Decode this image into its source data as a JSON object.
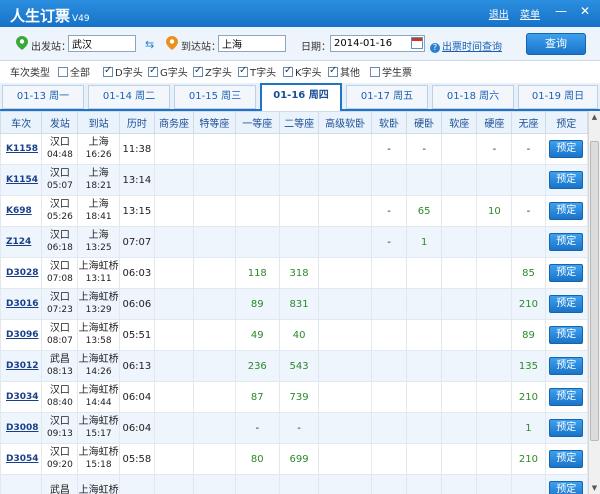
{
  "app": {
    "title": "人生订票",
    "version": "V49"
  },
  "titlebar": {
    "logout": "退出",
    "menu": "菜单",
    "minimize": "—",
    "close": "✕"
  },
  "search": {
    "from_label": "出发站：",
    "from_value": "武汉",
    "swap": "⇆",
    "to_label": "到达站：",
    "to_value": "上海",
    "date_label": "日期：",
    "date_value": "2014-01-16",
    "help_link": "出票时间查询",
    "query_button": "查询"
  },
  "filters": {
    "label": "车次类型",
    "options": [
      {
        "label": "全部",
        "checked": false
      },
      {
        "label": "D字头",
        "checked": true
      },
      {
        "label": "G字头",
        "checked": true
      },
      {
        "label": "Z字头",
        "checked": true
      },
      {
        "label": "T字头",
        "checked": true
      },
      {
        "label": "K字头",
        "checked": true
      },
      {
        "label": "其他",
        "checked": true
      },
      {
        "label": "学生票",
        "checked": false
      }
    ]
  },
  "date_tabs": [
    {
      "label": "01-13 周一",
      "active": false
    },
    {
      "label": "01-14 周二",
      "active": false
    },
    {
      "label": "01-15 周三",
      "active": false
    },
    {
      "label": "01-16 周四",
      "active": true
    },
    {
      "label": "01-17 周五",
      "active": false
    },
    {
      "label": "01-18 周六",
      "active": false
    },
    {
      "label": "01-19 周日",
      "active": false
    }
  ],
  "table": {
    "headers": [
      "车次",
      "发站",
      "到站",
      "历时",
      "商务座",
      "特等座",
      "一等座",
      "二等座",
      "高级软卧",
      "软卧",
      "硬卧",
      "软座",
      "硬座",
      "无座",
      "预定"
    ],
    "book_label": "预定",
    "rows": [
      {
        "train": "K1158",
        "from": "汉口",
        "dep": "04:48",
        "to": "上海",
        "arr": "16:26",
        "dur": "11:38",
        "seats": [
          "",
          "",
          "",
          "",
          "",
          "-",
          "-",
          "",
          "-",
          "-"
        ]
      },
      {
        "train": "K1154",
        "from": "汉口",
        "dep": "05:07",
        "to": "上海",
        "arr": "18:21",
        "dur": "13:14",
        "seats": [
          "",
          "",
          "",
          "",
          "",
          "",
          "",
          "",
          "",
          ""
        ]
      },
      {
        "train": "K698",
        "from": "汉口",
        "dep": "05:26",
        "to": "上海",
        "arr": "18:41",
        "dur": "13:15",
        "seats": [
          "",
          "",
          "",
          "",
          "",
          "-",
          "65",
          "",
          "10",
          "-"
        ]
      },
      {
        "train": "Z124",
        "from": "汉口",
        "dep": "06:18",
        "to": "上海",
        "arr": "13:25",
        "dur": "07:07",
        "seats": [
          "",
          "",
          "",
          "",
          "",
          "-",
          "1",
          "",
          "",
          ""
        ]
      },
      {
        "train": "D3028",
        "from": "汉口",
        "dep": "07:08",
        "to": "上海虹桥",
        "arr": "13:11",
        "dur": "06:03",
        "seats": [
          "",
          "",
          "118",
          "318",
          "",
          "",
          "",
          "",
          "",
          "85"
        ]
      },
      {
        "train": "D3016",
        "from": "汉口",
        "dep": "07:23",
        "to": "上海虹桥",
        "arr": "13:29",
        "dur": "06:06",
        "seats": [
          "",
          "",
          "89",
          "831",
          "",
          "",
          "",
          "",
          "",
          "210"
        ]
      },
      {
        "train": "D3096",
        "from": "汉口",
        "dep": "08:07",
        "to": "上海虹桥",
        "arr": "13:58",
        "dur": "05:51",
        "seats": [
          "",
          "",
          "49",
          "40",
          "",
          "",
          "",
          "",
          "",
          "89"
        ]
      },
      {
        "train": "D3012",
        "from": "武昌",
        "dep": "08:13",
        "to": "上海虹桥",
        "arr": "14:26",
        "dur": "06:13",
        "seats": [
          "",
          "",
          "236",
          "543",
          "",
          "",
          "",
          "",
          "",
          "135"
        ]
      },
      {
        "train": "D3034",
        "from": "汉口",
        "dep": "08:40",
        "to": "上海虹桥",
        "arr": "14:44",
        "dur": "06:04",
        "seats": [
          "",
          "",
          "87",
          "739",
          "",
          "",
          "",
          "",
          "",
          "210"
        ]
      },
      {
        "train": "D3008",
        "from": "汉口",
        "dep": "09:13",
        "to": "上海虹桥",
        "arr": "15:17",
        "dur": "06:04",
        "seats": [
          "",
          "",
          "-",
          "-",
          "",
          "",
          "",
          "",
          "",
          "1"
        ]
      },
      {
        "train": "D3054",
        "from": "汉口",
        "dep": "09:20",
        "to": "上海虹桥",
        "arr": "15:18",
        "dur": "05:58",
        "seats": [
          "",
          "",
          "80",
          "699",
          "",
          "",
          "",
          "",
          "",
          "210"
        ]
      },
      {
        "train": "",
        "from": "武昌",
        "dep": "",
        "to": "上海虹桥",
        "arr": "",
        "dur": "",
        "seats": [
          "",
          "",
          "",
          "",
          "",
          "",
          "",
          "",
          "",
          ""
        ]
      }
    ]
  },
  "colors": {
    "accent": "#1f74c9",
    "available": "#2a8a2a",
    "train_link": "#1a3f8a"
  }
}
